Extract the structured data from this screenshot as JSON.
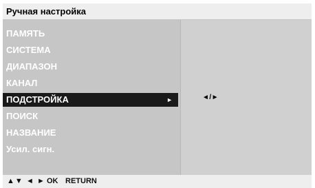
{
  "header": {
    "title": "Ручная настройка"
  },
  "menu": {
    "items": [
      {
        "label": "ПАМЯТЬ"
      },
      {
        "label": "СИСТЕМА"
      },
      {
        "label": "ДИАПАЗОН"
      },
      {
        "label": "КАНАЛ"
      },
      {
        "label": "ПОДСТРОЙКА",
        "selected": true,
        "arrow": "►"
      },
      {
        "label": "ПОИСК"
      },
      {
        "label": "НАЗВАНИЕ"
      },
      {
        "label": "Усил. сигн."
      }
    ]
  },
  "value_panel": {
    "adjust_hint": "◄/►"
  },
  "footer": {
    "updown": "▲▼",
    "leftright": "◄ ►",
    "ok": "OK",
    "return": "RETURN"
  },
  "colors": {
    "selected_bg": "#1a1a1a",
    "menu_bg": "#c6c6c6",
    "panel_bg": "#d0d0d0",
    "bar_bg": "#eeeeee"
  }
}
